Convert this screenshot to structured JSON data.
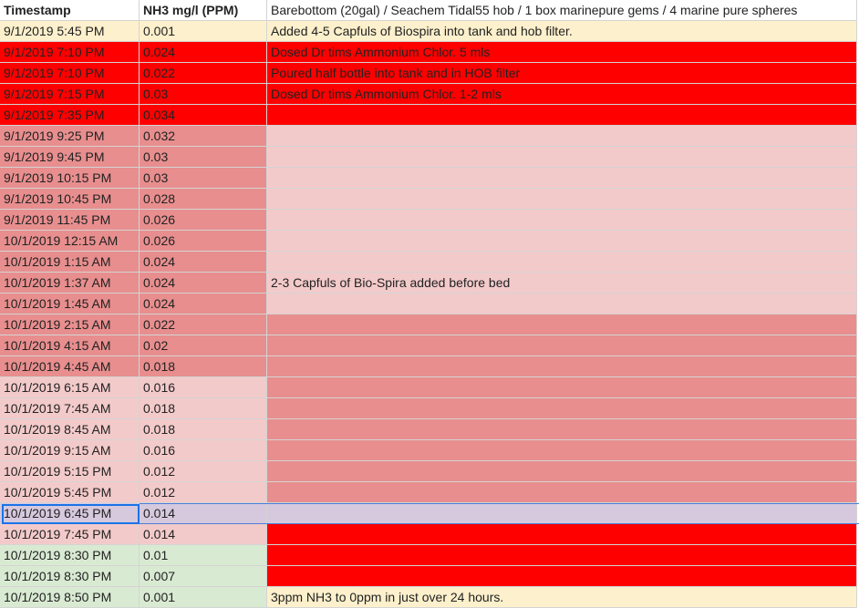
{
  "colors": {
    "cream": "#fdf0cc",
    "bright_red": "#ff0000",
    "salmon": "#e88e8e",
    "light_pink": "#f3caca",
    "light_green": "#d9ead3",
    "selected_lavender": "#d6c9de",
    "selection_blue": "#1a73e8"
  },
  "header": {
    "col_timestamp": "Timestamp",
    "col_nh3": "NH3 mg/l (PPM)",
    "col_notes": "Barebottom (20gal) / Seachem Tidal55 hob / 1 box marinepure gems  / 4 marine pure spheres"
  },
  "rows": [
    {
      "timestamp": "9/1/2019 5:45 PM",
      "nh3": "0.001",
      "note": "Added 4-5 Capfuls of Biospira into tank and hob filter.",
      "bg": [
        "#fdf0cc",
        "#fdf0cc",
        "#fdf0cc"
      ]
    },
    {
      "timestamp": "9/1/2019 7:10 PM",
      "nh3": "0.024",
      "note": "Dosed Dr tims Ammonium Chlor. 5 mls",
      "bg": [
        "#ff0000",
        "#ff0000",
        "#ff0000"
      ]
    },
    {
      "timestamp": "9/1/2019 7:10 PM",
      "nh3": "0.022",
      "note": "Poured half bottle into tank and in HOB filter",
      "bg": [
        "#ff0000",
        "#ff0000",
        "#ff0000"
      ]
    },
    {
      "timestamp": "9/1/2019 7:15 PM",
      "nh3": "0.03",
      "note": "Dosed Dr tims Ammonium Chlor. 1-2 mls",
      "bg": [
        "#ff0000",
        "#ff0000",
        "#ff0000"
      ]
    },
    {
      "timestamp": "9/1/2019 7:35 PM",
      "nh3": "0.034",
      "note": "",
      "bg": [
        "#ff0000",
        "#ff0000",
        "#ff0000"
      ]
    },
    {
      "timestamp": "9/1/2019 9:25 PM",
      "nh3": "0.032",
      "note": "",
      "bg": [
        "#e88e8e",
        "#e88e8e",
        "#f3caca"
      ]
    },
    {
      "timestamp": "9/1/2019 9:45 PM",
      "nh3": "0.03",
      "note": "",
      "bg": [
        "#e88e8e",
        "#e88e8e",
        "#f3caca"
      ]
    },
    {
      "timestamp": "9/1/2019 10:15 PM",
      "nh3": "0.03",
      "note": "",
      "bg": [
        "#e88e8e",
        "#e88e8e",
        "#f3caca"
      ]
    },
    {
      "timestamp": "9/1/2019 10:45 PM",
      "nh3": "0.028",
      "note": "",
      "bg": [
        "#e88e8e",
        "#e88e8e",
        "#f3caca"
      ]
    },
    {
      "timestamp": "9/1/2019 11:45 PM",
      "nh3": "0.026",
      "note": "",
      "bg": [
        "#e88e8e",
        "#e88e8e",
        "#f3caca"
      ]
    },
    {
      "timestamp": "10/1/2019 12:15 AM",
      "nh3": "0.026",
      "note": "",
      "bg": [
        "#e88e8e",
        "#e88e8e",
        "#f3caca"
      ]
    },
    {
      "timestamp": "10/1/2019 1:15 AM",
      "nh3": "0.024",
      "note": "",
      "bg": [
        "#e88e8e",
        "#e88e8e",
        "#f3caca"
      ]
    },
    {
      "timestamp": "10/1/2019 1:37 AM",
      "nh3": "0.024",
      "note": "2-3 Capfuls of Bio-Spira added before bed",
      "bg": [
        "#e88e8e",
        "#e88e8e",
        "#f3caca"
      ]
    },
    {
      "timestamp": "10/1/2019 1:45 AM",
      "nh3": "0.024",
      "note": "",
      "bg": [
        "#e88e8e",
        "#e88e8e",
        "#f3caca"
      ]
    },
    {
      "timestamp": "10/1/2019 2:15 AM",
      "nh3": "0.022",
      "note": "",
      "bg": [
        "#e88e8e",
        "#e88e8e",
        "#e88e8e"
      ]
    },
    {
      "timestamp": "10/1/2019 4:15 AM",
      "nh3": "0.02",
      "note": "",
      "bg": [
        "#e88e8e",
        "#e88e8e",
        "#e88e8e"
      ]
    },
    {
      "timestamp": "10/1/2019 4:45 AM",
      "nh3": "0.018",
      "note": "",
      "bg": [
        "#e88e8e",
        "#e88e8e",
        "#e88e8e"
      ]
    },
    {
      "timestamp": "10/1/2019 6:15 AM",
      "nh3": "0.016",
      "note": "",
      "bg": [
        "#f3caca",
        "#f3caca",
        "#e88e8e"
      ]
    },
    {
      "timestamp": "10/1/2019 7:45 AM",
      "nh3": "0.018",
      "note": "",
      "bg": [
        "#f3caca",
        "#f3caca",
        "#e88e8e"
      ]
    },
    {
      "timestamp": "10/1/2019 8:45 AM",
      "nh3": "0.018",
      "note": "",
      "bg": [
        "#f3caca",
        "#f3caca",
        "#e88e8e"
      ]
    },
    {
      "timestamp": "10/1/2019 9:15 AM",
      "nh3": "0.016",
      "note": "",
      "bg": [
        "#f3caca",
        "#f3caca",
        "#e88e8e"
      ]
    },
    {
      "timestamp": "10/1/2019 5:15 PM",
      "nh3": "0.012",
      "note": "",
      "bg": [
        "#f3caca",
        "#f3caca",
        "#e88e8e"
      ]
    },
    {
      "timestamp": "10/1/2019 5:45 PM",
      "nh3": "0.012",
      "note": "",
      "bg": [
        "#f3caca",
        "#f3caca",
        "#e88e8e"
      ]
    },
    {
      "timestamp": "10/1/2019 6:45 PM",
      "nh3": "0.014",
      "note": "",
      "bg": [
        "#d6c9de",
        "#d6c9de",
        "#d6c9de"
      ],
      "selected": true
    },
    {
      "timestamp": "10/1/2019 7:45 PM",
      "nh3": "0.014",
      "note": "",
      "bg": [
        "#f3caca",
        "#f3caca",
        "#ff0000"
      ]
    },
    {
      "timestamp": "10/1/2019 8:30 PM",
      "nh3": "0.01",
      "note": "",
      "bg": [
        "#d9ead3",
        "#d9ead3",
        "#ff0000"
      ]
    },
    {
      "timestamp": "10/1/2019 8:30 PM",
      "nh3": "0.007",
      "note": "",
      "bg": [
        "#d9ead3",
        "#d9ead3",
        "#ff0000"
      ]
    },
    {
      "timestamp": "10/1/2019 8:50 PM",
      "nh3": "0.001",
      "note": "3ppm NH3 to 0ppm in just over 24 hours.",
      "bg": [
        "#d9ead3",
        "#d9ead3",
        "#fdf0cc"
      ]
    }
  ]
}
